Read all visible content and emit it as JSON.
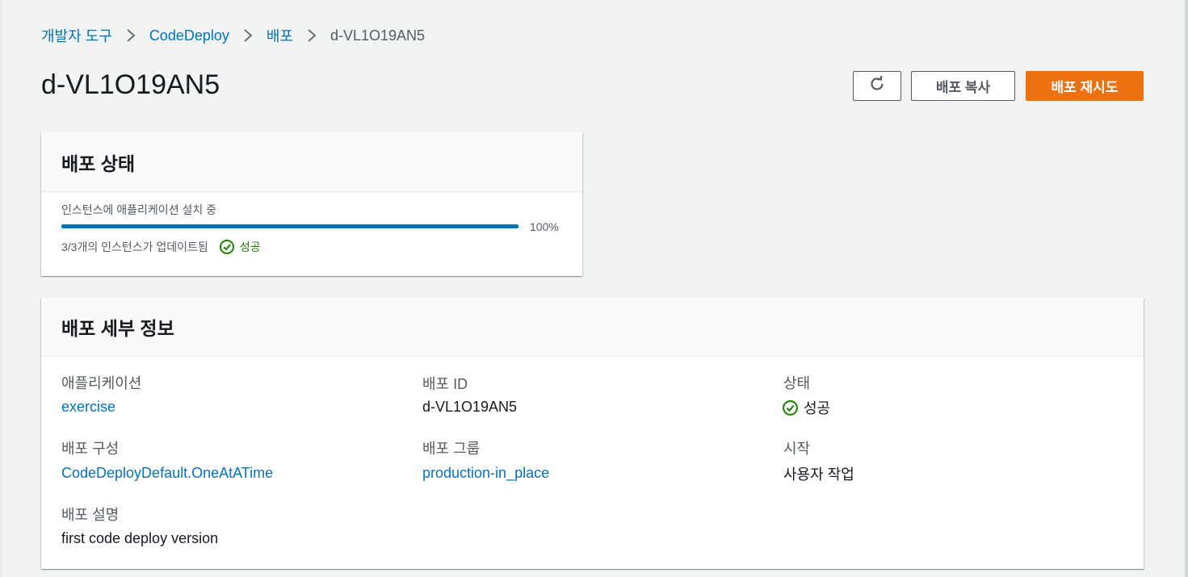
{
  "breadcrumb": {
    "items": [
      "개발자 도구",
      "CodeDeploy",
      "배포"
    ],
    "current": "d-VL1O19AN5"
  },
  "header": {
    "title": "d-VL1O19AN5",
    "refresh_icon": "refresh-icon",
    "copy_label": "배포 복사",
    "retry_label": "배포 재시도"
  },
  "colors": {
    "accent": "#ec7211",
    "link": "#0073bb",
    "success": "#1d8102",
    "progress": "#0073bb"
  },
  "status": {
    "heading": "배포 상태",
    "description": "인스턴스에 애플리케이션 설치 중",
    "progress_percent": 100,
    "progress_label": "100%",
    "summary": "3/3개의 인스턴스가 업데이트됨",
    "result_icon": "check-circle-icon",
    "result": "성공"
  },
  "details": {
    "heading": "배포 세부 정보",
    "application": {
      "label": "애플리케이션",
      "value": "exercise"
    },
    "deployment_id": {
      "label": "배포 ID",
      "value": "d-VL1O19AN5"
    },
    "state": {
      "label": "상태",
      "value": "성공",
      "icon": "check-circle-icon"
    },
    "config": {
      "label": "배포 구성",
      "value": "CodeDeployDefault.OneAtATime"
    },
    "group": {
      "label": "배포 그룹",
      "value": "production-in_place"
    },
    "initiator": {
      "label": "시작",
      "value": "사용자 작업"
    },
    "description": {
      "label": "배포 설명",
      "value": "first code deploy version"
    }
  }
}
